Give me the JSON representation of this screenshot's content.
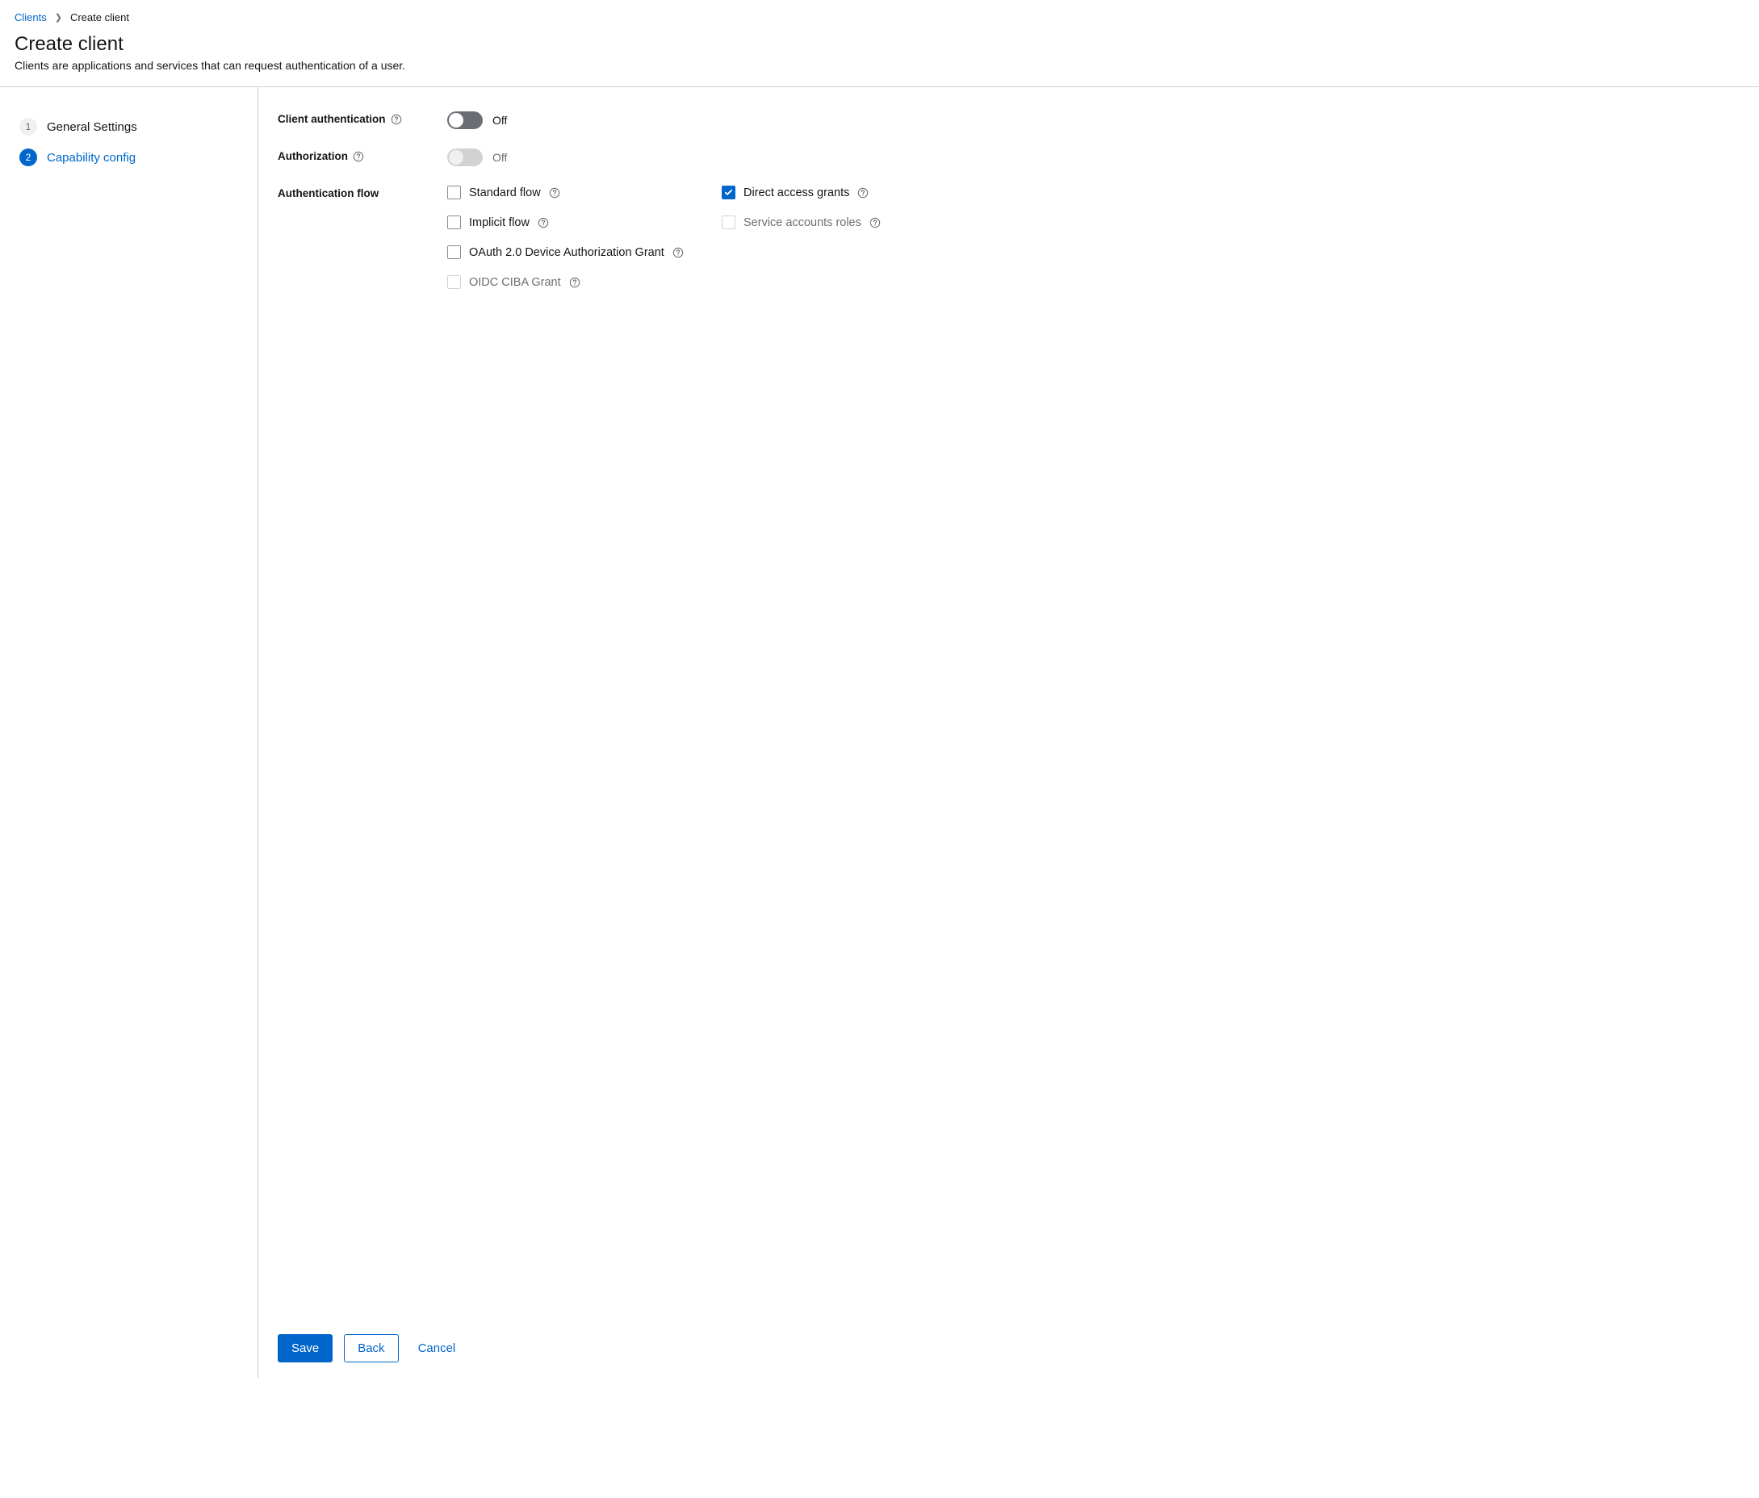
{
  "breadcrumb": {
    "parent": "Clients",
    "current": "Create client"
  },
  "header": {
    "title": "Create client",
    "description": "Clients are applications and services that can request authentication of a user."
  },
  "wizard": {
    "step1_num": "1",
    "step1_label": "General Settings",
    "step2_num": "2",
    "step2_label": "Capability config"
  },
  "form": {
    "client_auth_label": "Client authentication",
    "authorization_label": "Authorization",
    "auth_flow_label": "Authentication flow",
    "off_text1": "Off",
    "off_text2": "Off",
    "flows": {
      "standard": "Standard flow",
      "direct": "Direct access grants",
      "implicit": "Implicit flow",
      "service": "Service accounts roles",
      "device": "OAuth 2.0 Device Authorization Grant",
      "ciba": "OIDC CIBA Grant"
    }
  },
  "footer": {
    "save": "Save",
    "back": "Back",
    "cancel": "Cancel"
  }
}
